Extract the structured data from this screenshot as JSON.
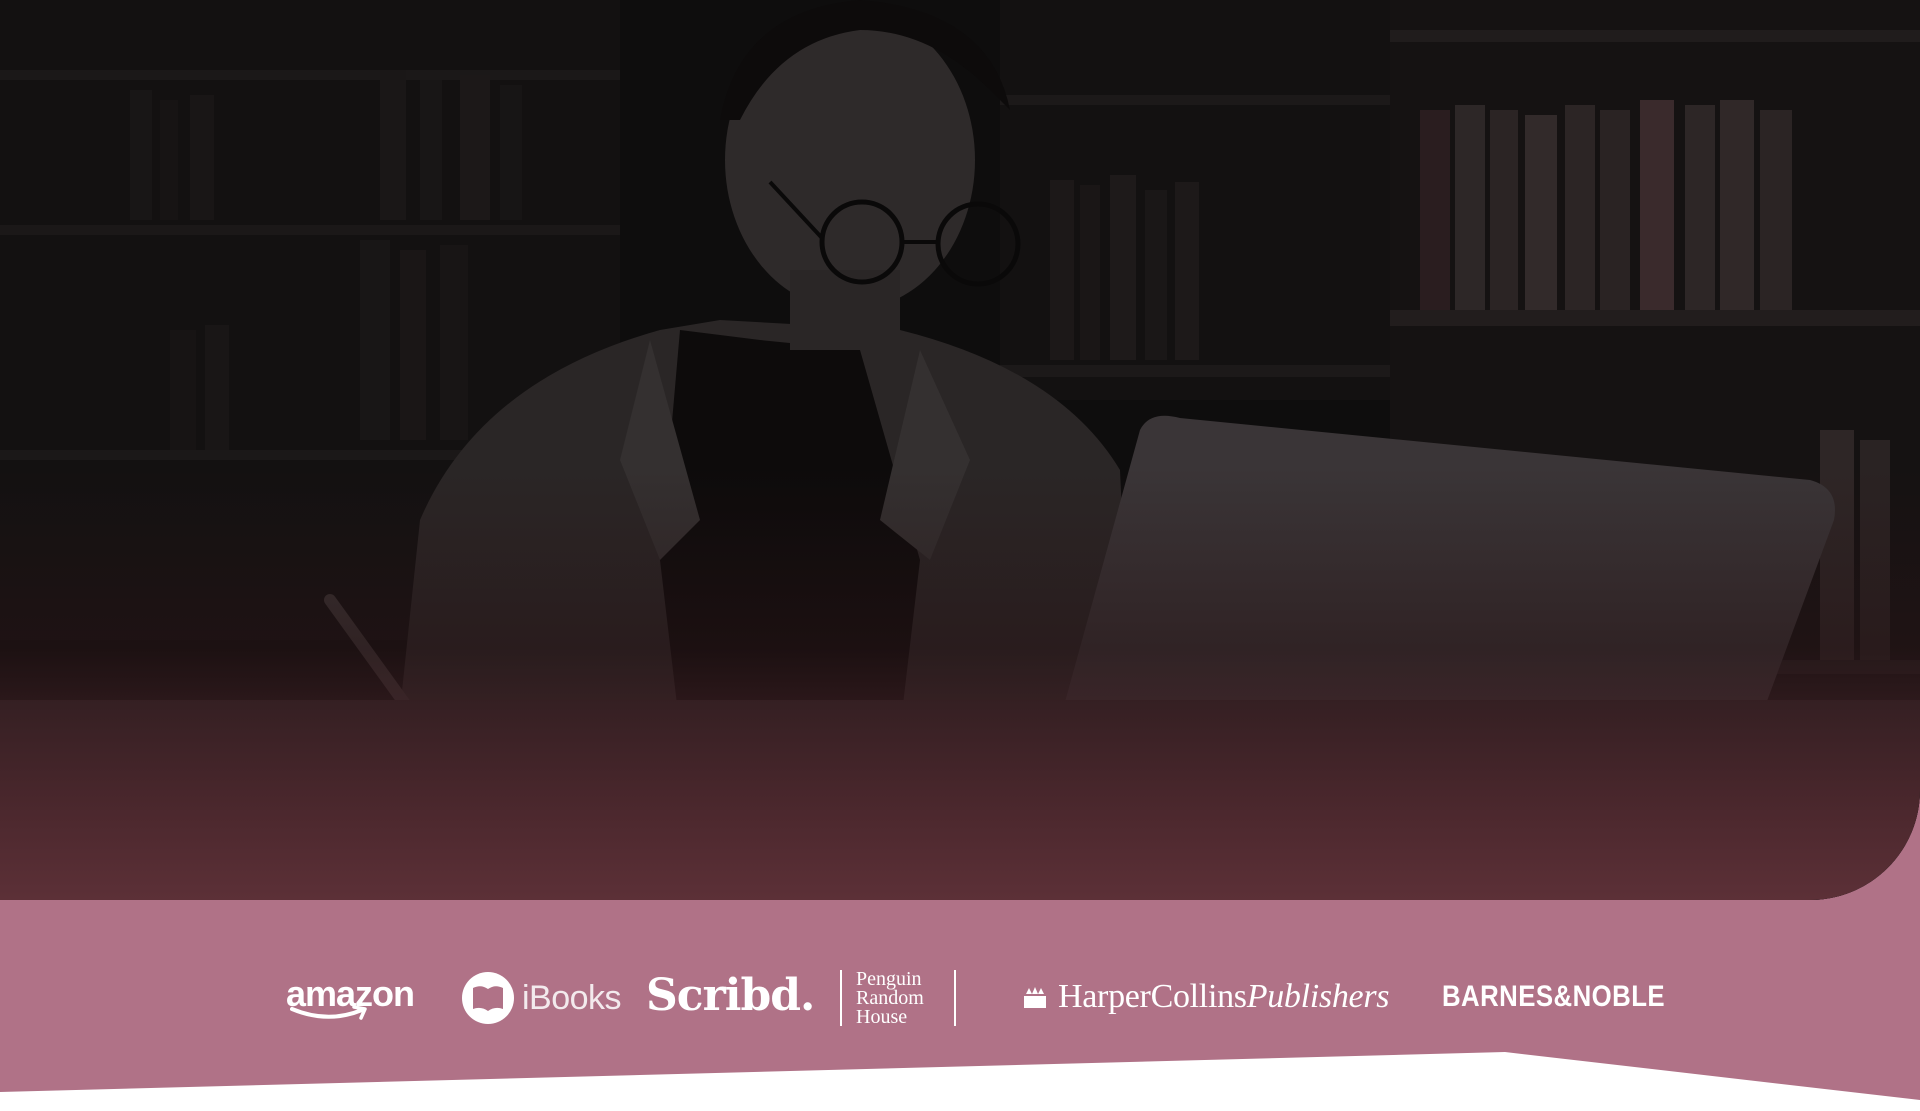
{
  "colors": {
    "band": "#b07287",
    "hero_overlay_bottom": "#5c3037",
    "logo": "#ffffff",
    "page_bg": "#ffffff"
  },
  "hero": {
    "image": "woman-with-glasses-using-laptop-in-library-photo"
  },
  "partners": {
    "amazon": "amazon",
    "ibooks": "iBooks",
    "scribd": "Scribd.",
    "penguin_line1": "Penguin",
    "penguin_line2": "Random",
    "penguin_line3": "House",
    "harpercollins_main": "HarperCollins",
    "harpercollins_italic": "Publishers",
    "barnes_noble": "BARNES&NOBLE"
  }
}
